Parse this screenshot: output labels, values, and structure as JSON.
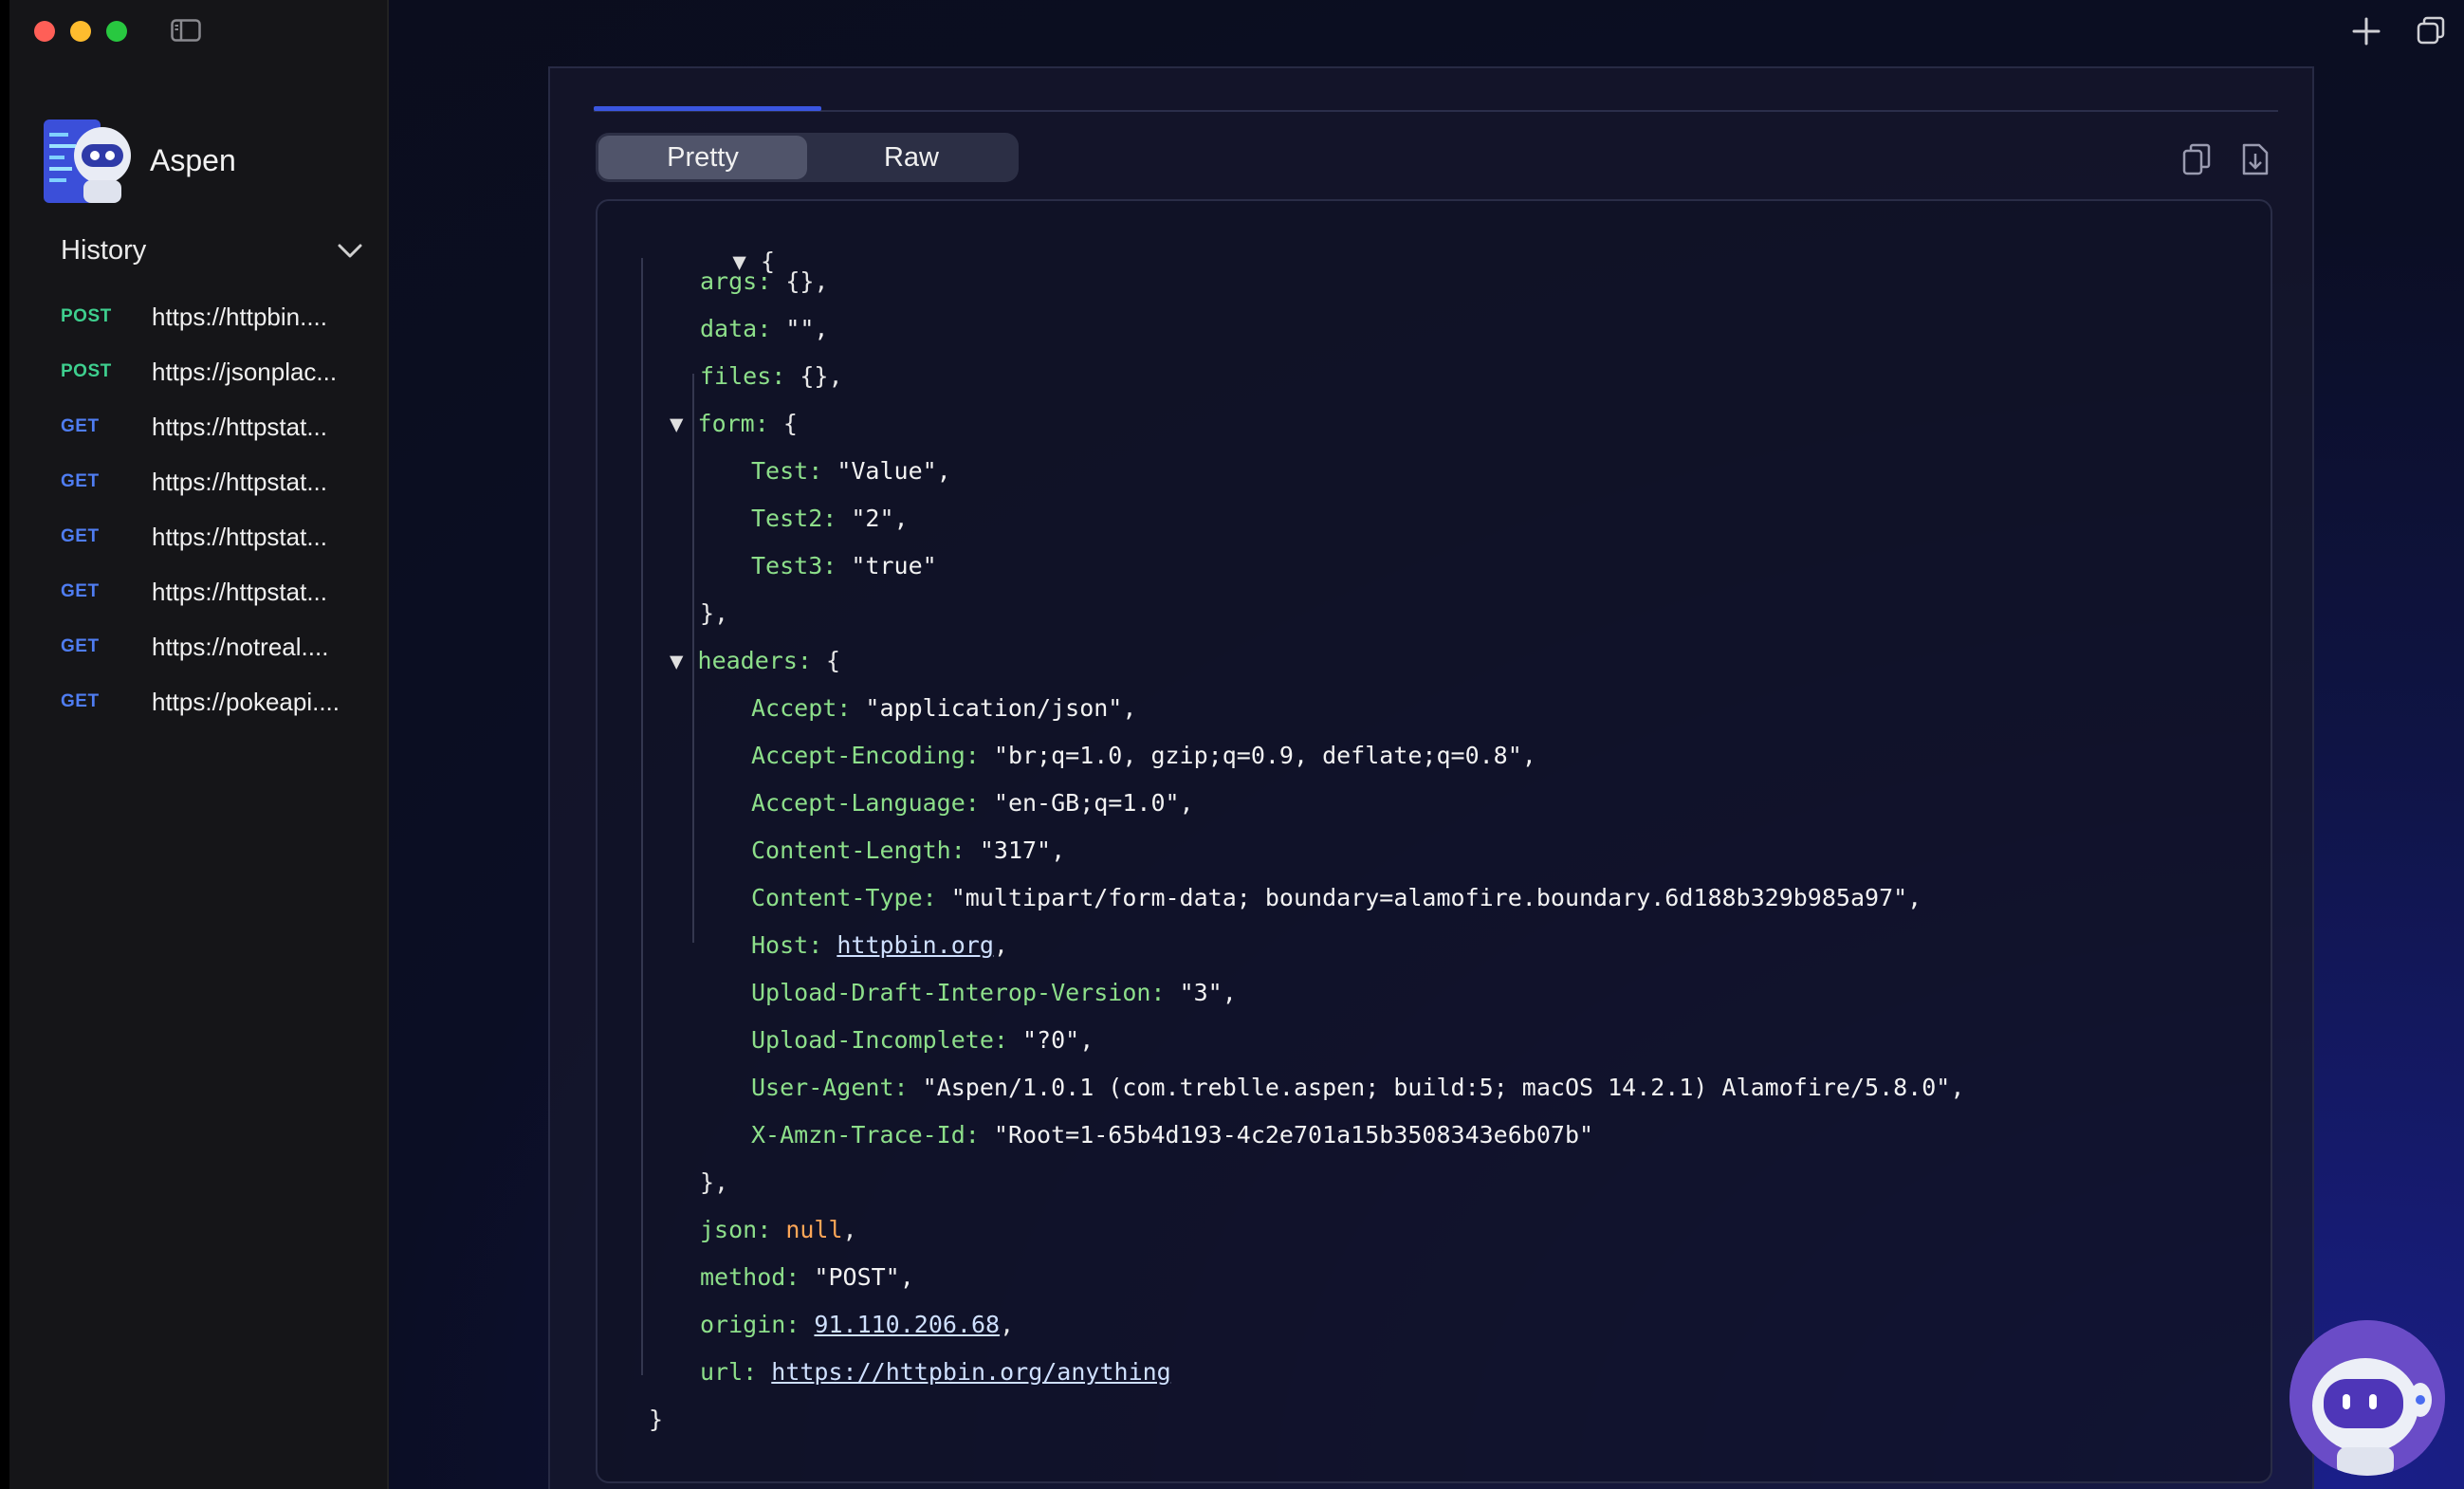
{
  "app": {
    "name": "Aspen"
  },
  "history": {
    "title": "History",
    "items": [
      {
        "method": "POST",
        "url": "https://httpbin...."
      },
      {
        "method": "POST",
        "url": "https://jsonplac..."
      },
      {
        "method": "GET",
        "url": "https://httpstat..."
      },
      {
        "method": "GET",
        "url": "https://httpstat..."
      },
      {
        "method": "GET",
        "url": "https://httpstat..."
      },
      {
        "method": "GET",
        "url": "https://httpstat..."
      },
      {
        "method": "GET",
        "url": "https://notreal...."
      },
      {
        "method": "GET",
        "url": "https://pokeapi...."
      }
    ]
  },
  "view_toggle": {
    "pretty": "Pretty",
    "raw": "Raw",
    "selected": "Pretty"
  },
  "json": {
    "open_brace": "{",
    "close_brace": "}",
    "args_key": "args:",
    "args_val": "{},",
    "data_key": "data:",
    "data_val": "\"\",",
    "files_key": "files:",
    "files_val": "{},",
    "form_key": "form:",
    "form_open": "{",
    "form_test_key": "Test:",
    "form_test_val": "\"Value\",",
    "form_test2_key": "Test2:",
    "form_test2_val": "\"2\",",
    "form_test3_key": "Test3:",
    "form_test3_val": "\"true\"",
    "form_close": "},",
    "headers_key": "headers:",
    "headers_open": "{",
    "h_accept_key": "Accept:",
    "h_accept_val": "\"application/json\",",
    "h_enc_key": "Accept-Encoding:",
    "h_enc_val": "\"br;q=1.0, gzip;q=0.9, deflate;q=0.8\",",
    "h_lang_key": "Accept-Language:",
    "h_lang_val": "\"en-GB;q=1.0\",",
    "h_len_key": "Content-Length:",
    "h_len_val": "\"317\",",
    "h_type_key": "Content-Type:",
    "h_type_val": "\"multipart/form-data; boundary=alamofire.boundary.6d188b329b985a97\",",
    "h_host_key": "Host:",
    "h_host_val": "httpbin.org",
    "h_host_comma": ",",
    "h_udiv_key": "Upload-Draft-Interop-Version:",
    "h_udiv_val": "\"3\",",
    "h_uinc_key": "Upload-Incomplete:",
    "h_uinc_val": "\"?0\",",
    "h_ua_key": "User-Agent:",
    "h_ua_val": "\"Aspen/1.0.1 (com.treblle.aspen; build:5; macOS 14.2.1) Alamofire/5.8.0\",",
    "h_trace_key": "X-Amzn-Trace-Id:",
    "h_trace_val": "\"Root=1-65b4d193-4c2e701a15b3508343e6b07b\"",
    "headers_close": "},",
    "json_key": "json:",
    "json_val": "null",
    "json_comma": ",",
    "method_key": "method:",
    "method_val": "\"POST\",",
    "origin_key": "origin:",
    "origin_val": "91.110.206.68",
    "origin_comma": ",",
    "url_key": "url:",
    "url_val": "https://httpbin.org/anything"
  },
  "colors": {
    "post": "#3ecf8e",
    "get": "#4f7df2",
    "json_key": "#8ddf8a",
    "json_null": "#ffa657",
    "accent": "#3a56e0"
  }
}
